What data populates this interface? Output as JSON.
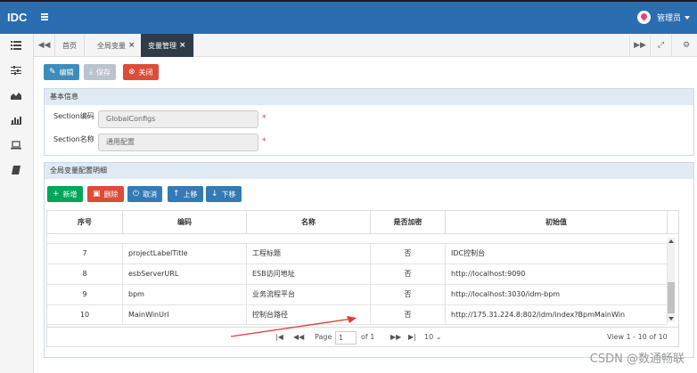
{
  "header": {
    "brand": "IDC",
    "user": "管理员"
  },
  "tabs": [
    {
      "label": "首页",
      "closable": false,
      "active": false
    },
    {
      "label": "全局变量",
      "closable": true,
      "active": false
    },
    {
      "label": "变量管理",
      "closable": true,
      "active": true
    }
  ],
  "close_mark": "×",
  "toolbar": {
    "edit": "编辑",
    "save": "保存",
    "close": "关闭"
  },
  "basic": {
    "title": "基本信息",
    "section_code_label": "Section编码",
    "section_code_value": "GlobalConfigs",
    "section_name_label": "Section名称",
    "section_name_value": "通用配置",
    "required_mark": "*"
  },
  "detail": {
    "title": "全局变量配置明细",
    "buttons": {
      "add": "新增",
      "delete": "删除",
      "cancel": "取消",
      "up": "上移",
      "down": "下移"
    }
  },
  "grid": {
    "columns": [
      "序号",
      "编码",
      "名称",
      "是否加密",
      "初始值"
    ],
    "rows": [
      {
        "no": "7",
        "code": "projectLabelTitle",
        "name": "工程标题",
        "encrypted": "否",
        "value": "IDC控制台"
      },
      {
        "no": "8",
        "code": "esbServerURL",
        "name": "ESB访问地址",
        "encrypted": "否",
        "value": "http://localhost:9090"
      },
      {
        "no": "9",
        "code": "bpm",
        "name": "业务流程平台",
        "encrypted": "否",
        "value": "http://localhost:3030/idm-bpm"
      },
      {
        "no": "10",
        "code": "MainWinUrl",
        "name": "控制台路径",
        "encrypted": "否",
        "value": "http://175.31.224.8:802/idm/index?BpmMainWin"
      }
    ]
  },
  "pager": {
    "page_label": "Page",
    "page": "1",
    "of": "of 1",
    "page_size": "10",
    "view": "View 1 - 10 of 10"
  },
  "watermark": "CSDN @数通畅联",
  "colors": {
    "topbar": "#2a6db0",
    "active_tab": "#2f3b46",
    "annotation_arrow": "#e53935"
  }
}
